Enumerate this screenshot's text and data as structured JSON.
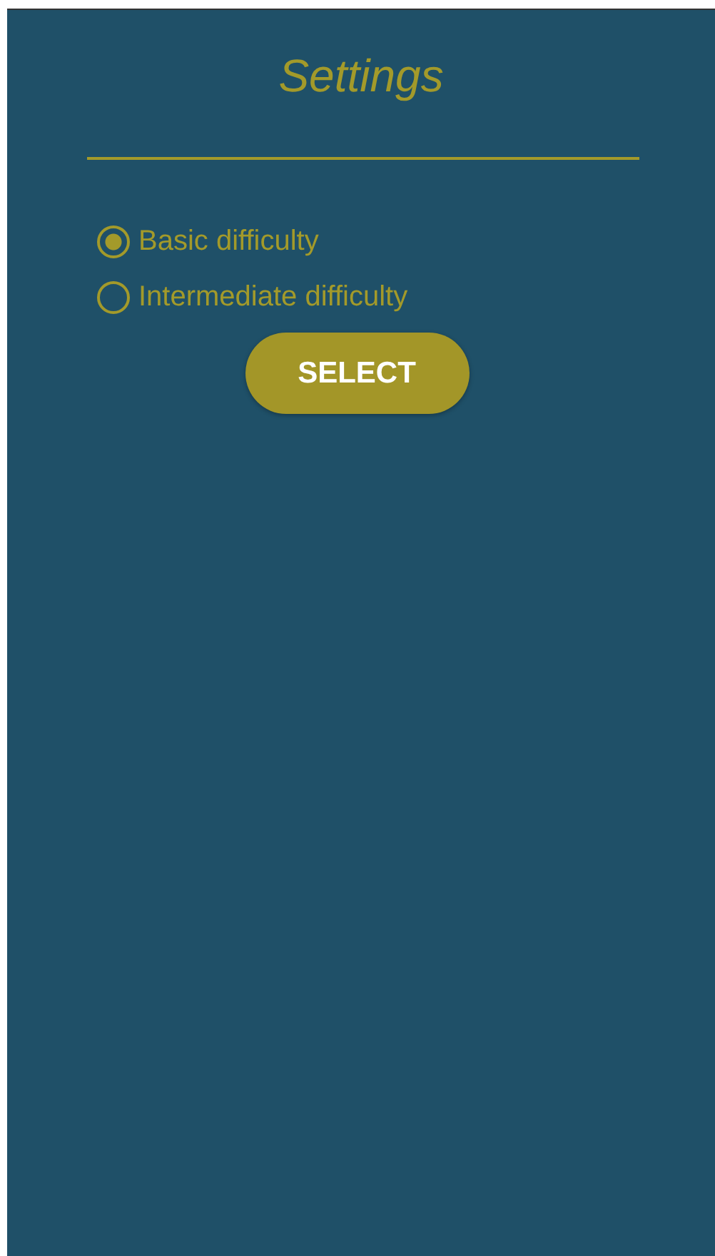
{
  "title": "Settings",
  "options": [
    {
      "label": "Basic difficulty",
      "selected": true
    },
    {
      "label": "Intermediate difficulty",
      "selected": false
    }
  ],
  "button": "SELECT"
}
